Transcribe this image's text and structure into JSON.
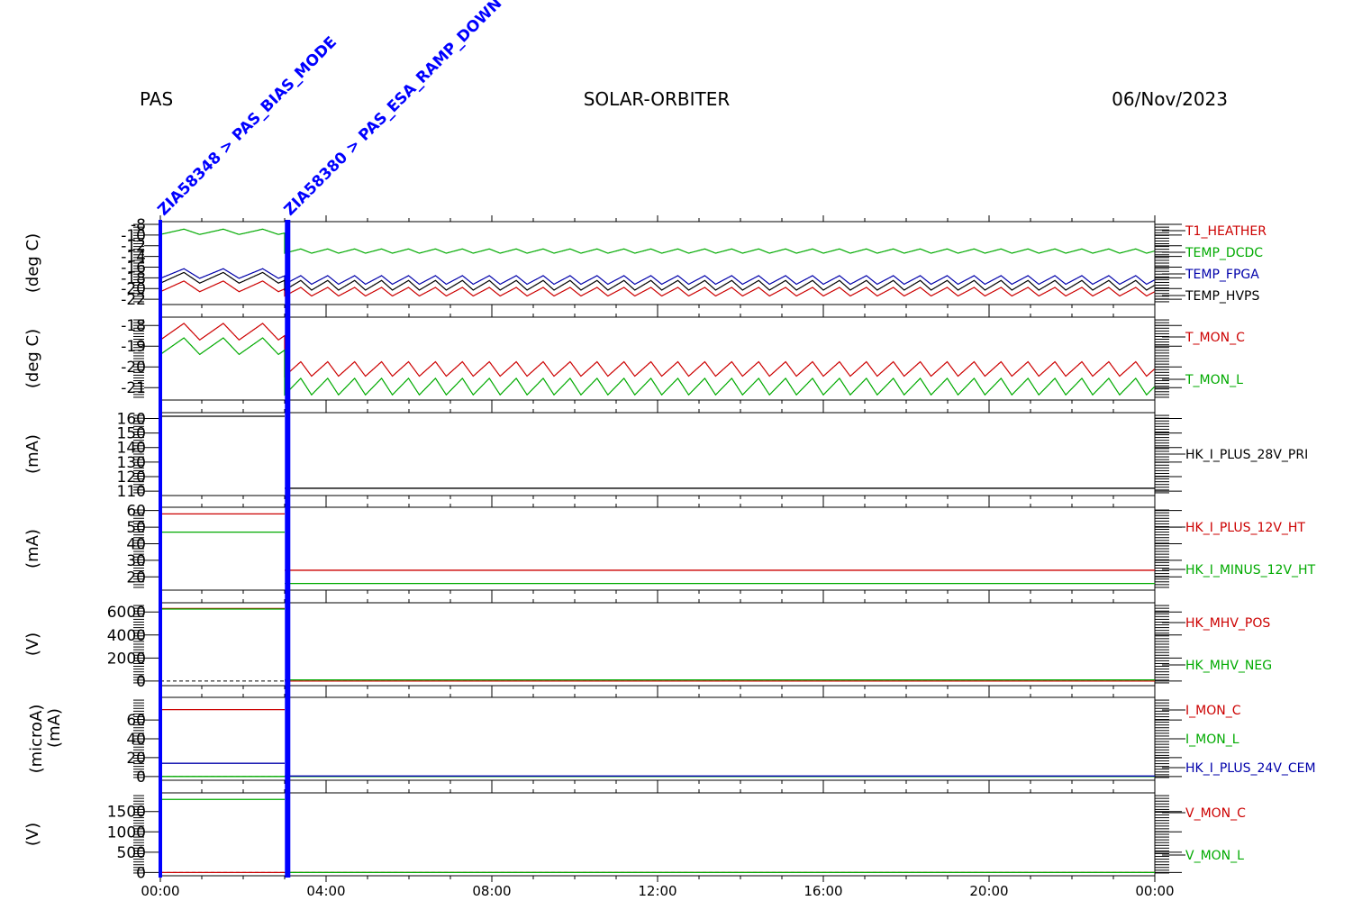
{
  "header": {
    "instrument": "PAS",
    "mission": "SOLAR-ORBITER",
    "date": "06/Nov/2023"
  },
  "colors": {
    "red": "#cc0000",
    "green": "#00aa00",
    "blue": "#0000aa",
    "black": "#000000",
    "marker": "#0000ff"
  },
  "chart_data": [
    {
      "type": "line",
      "ylabel": "(deg C)",
      "ylim": [
        -23,
        -7.5
      ],
      "yticks": [
        -22,
        -20,
        -18,
        -16,
        -14,
        -12,
        -10,
        -8
      ],
      "yticklabels": [
        "-22",
        "-20",
        "-18",
        "-16",
        "-14",
        "-12",
        "-10",
        "-8"
      ],
      "xlim_hours": [
        0,
        24
      ],
      "series": [
        {
          "name": "T1_HEATHER",
          "color": "red",
          "mode": "periodic",
          "phases": [
            {
              "t0": 0.0,
              "t1": 3.0,
              "base": -19.6,
              "amp": 1.0,
              "period": 0.95
            },
            {
              "t0": 3.0,
              "t1": 24.0,
              "base": -20.6,
              "amp": 0.8,
              "period": 0.65
            }
          ]
        },
        {
          "name": "TEMP_DCDC",
          "color": "green",
          "mode": "periodic",
          "phases": [
            {
              "t0": 0.0,
              "t1": 3.0,
              "base": -9.4,
              "amp": 0.5,
              "period": 0.95
            },
            {
              "t0": 3.0,
              "t1": 24.0,
              "base": -13.0,
              "amp": 0.4,
              "period": 0.65
            }
          ]
        },
        {
          "name": "TEMP_FPGA",
          "color": "blue",
          "mode": "periodic",
          "phases": [
            {
              "t0": 0.0,
              "t1": 3.0,
              "base": -17.2,
              "amp": 0.9,
              "period": 0.95
            },
            {
              "t0": 3.0,
              "t1": 24.0,
              "base": -18.4,
              "amp": 0.8,
              "period": 0.65
            }
          ]
        },
        {
          "name": "TEMP_HVPS",
          "color": "black",
          "mode": "periodic",
          "phases": [
            {
              "t0": 0.0,
              "t1": 3.0,
              "base": -18.0,
              "amp": 1.0,
              "period": 0.95
            },
            {
              "t0": 3.0,
              "t1": 24.0,
              "base": -19.4,
              "amp": 0.9,
              "period": 0.65
            }
          ]
        }
      ]
    },
    {
      "type": "line",
      "ylabel": "(deg C)",
      "ylim": [
        -21.6,
        -17.6
      ],
      "yticks": [
        -21,
        -20,
        -19,
        -18
      ],
      "yticklabels": [
        "-21",
        "-20",
        "-19",
        "-18"
      ],
      "xlim_hours": [
        0,
        24
      ],
      "series": [
        {
          "name": "T_MON_C",
          "color": "red",
          "mode": "periodic",
          "phases": [
            {
              "t0": 0.0,
              "t1": 3.0,
              "base": -18.3,
              "amp": 0.4,
              "period": 0.95
            },
            {
              "t0": 3.0,
              "t1": 24.0,
              "base": -20.1,
              "amp": 0.35,
              "period": 0.65
            }
          ]
        },
        {
          "name": "T_MON_L",
          "color": "green",
          "mode": "periodic",
          "phases": [
            {
              "t0": 0.0,
              "t1": 3.0,
              "base": -19.0,
              "amp": 0.4,
              "period": 0.95
            },
            {
              "t0": 3.0,
              "t1": 24.0,
              "base": -20.95,
              "amp": 0.4,
              "period": 0.65
            }
          ]
        }
      ]
    },
    {
      "type": "line",
      "ylabel": "(mA)",
      "ylim": [
        107,
        164
      ],
      "yticks": [
        110,
        120,
        130,
        140,
        150,
        160
      ],
      "yticklabels": [
        "110",
        "120",
        "130",
        "140",
        "150",
        "160"
      ],
      "xlim_hours": [
        0,
        24
      ],
      "series": [
        {
          "name": "HK_I_PLUS_28V_PRI",
          "color": "black",
          "mode": "steps",
          "segments": [
            {
              "t0": 0.0,
              "t1": 3.0,
              "value": 161.5
            },
            {
              "t0": 3.0,
              "t1": 24.0,
              "value": 112.0
            }
          ]
        }
      ]
    },
    {
      "type": "line",
      "ylabel": "(mA)",
      "ylim": [
        12,
        62
      ],
      "yticks": [
        20,
        30,
        40,
        50,
        60
      ],
      "yticklabels": [
        "20",
        "30",
        "40",
        "50",
        "60"
      ],
      "xlim_hours": [
        0,
        24
      ],
      "series": [
        {
          "name": "HK_I_PLUS_12V_HT",
          "color": "red",
          "mode": "steps",
          "segments": [
            {
              "t0": 0.0,
              "t1": 3.0,
              "value": 58.0
            },
            {
              "t0": 3.0,
              "t1": 24.0,
              "value": 24.0
            }
          ]
        },
        {
          "name": "HK_I_MINUS_12V_HT",
          "color": "green",
          "mode": "steps",
          "segments": [
            {
              "t0": 0.0,
              "t1": 3.0,
              "value": 47.0
            },
            {
              "t0": 3.0,
              "t1": 24.0,
              "value": 16.0
            }
          ]
        }
      ]
    },
    {
      "type": "line",
      "ylabel": "(V)",
      "ylim": [
        -400,
        6800
      ],
      "yticks": [
        0,
        2000,
        4000,
        6000
      ],
      "yticklabels": [
        "0",
        "2000",
        "4000",
        "6000"
      ],
      "xlim_hours": [
        0,
        24
      ],
      "series": [
        {
          "name": "HK_MHV_POS",
          "color": "red",
          "mode": "steps",
          "segments": [
            {
              "t0": 0.0,
              "t1": 3.0,
              "value": 6300.0
            },
            {
              "t0": 3.0,
              "t1": 24.0,
              "value": 0.0
            }
          ]
        },
        {
          "name": "HK_MHV_NEG",
          "color": "green",
          "mode": "steps",
          "segments": [
            {
              "t0": 0.0,
              "t1": 3.0,
              "value": 6250.0
            },
            {
              "t0": 3.0,
              "t1": 24.0,
              "value": 100.0
            }
          ]
        }
      ],
      "zero_line": true
    },
    {
      "type": "line",
      "ylabel": "(microA)",
      "ylabel2": "(mA)",
      "ylim": [
        -4,
        84
      ],
      "yticks": [
        0,
        20,
        40,
        60
      ],
      "yticklabels": [
        "0",
        "20",
        "40",
        "60"
      ],
      "xlim_hours": [
        0,
        24
      ],
      "series": [
        {
          "name": "I_MON_C",
          "color": "red",
          "mode": "steps",
          "segments": [
            {
              "t0": 0.0,
              "t1": 3.0,
              "value": 71.0
            },
            {
              "t0": 3.0,
              "t1": 24.0,
              "value": 0.0
            }
          ]
        },
        {
          "name": "I_MON_L",
          "color": "green",
          "mode": "steps",
          "segments": [
            {
              "t0": 0.0,
              "t1": 3.0,
              "value": 0.0
            },
            {
              "t0": 3.0,
              "t1": 24.0,
              "value": 0.0
            }
          ]
        },
        {
          "name": "HK_I_PLUS_24V_CEM",
          "color": "blue",
          "mode": "steps",
          "segments": [
            {
              "t0": 0.0,
              "t1": 3.0,
              "value": 14.0
            },
            {
              "t0": 3.0,
              "t1": 24.0,
              "value": 0.5
            }
          ]
        }
      ],
      "zero_line": true
    },
    {
      "type": "line",
      "ylabel": "(V)",
      "ylim": [
        -80,
        1960
      ],
      "yticks": [
        0,
        500,
        1000,
        1500
      ],
      "yticklabels": [
        "0",
        "500",
        "1000",
        "1500"
      ],
      "xlim_hours": [
        0,
        24
      ],
      "series": [
        {
          "name": "V_MON_C",
          "color": "red",
          "mode": "steps",
          "segments": [
            {
              "t0": 0.0,
              "t1": 3.0,
              "value": 0.0
            },
            {
              "t0": 3.0,
              "t1": 24.0,
              "value": 0.0
            }
          ]
        },
        {
          "name": "V_MON_L",
          "color": "green",
          "mode": "steps",
          "segments": [
            {
              "t0": 0.0,
              "t1": 3.0,
              "value": 1800.0
            },
            {
              "t0": 3.0,
              "t1": 24.0,
              "value": 0.0
            }
          ]
        }
      ],
      "zero_line": true
    }
  ],
  "xaxis": {
    "ticks_hours": [
      0,
      4,
      8,
      12,
      16,
      20,
      24
    ],
    "labels": [
      "00:00",
      "04:00",
      "08:00",
      "12:00",
      "16:00",
      "20:00",
      "00:00"
    ]
  },
  "markers": [
    {
      "t": 0.0,
      "id": "ZIA58348",
      "text": "ZIA58348 > PAS_BIAS_MODE"
    },
    {
      "t": 3.05,
      "id": "ZIA58380",
      "text": "ZIA58380 > PAS_ESA_RAMP_DOWN"
    }
  ]
}
